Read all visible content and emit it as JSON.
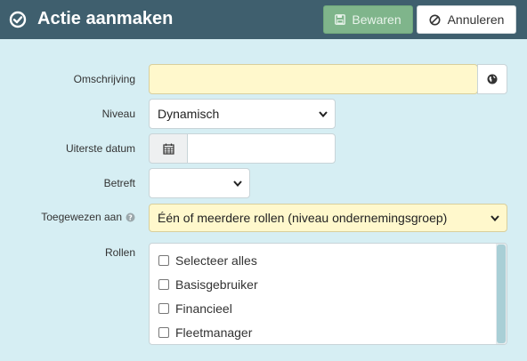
{
  "header": {
    "title": "Actie aanmaken",
    "save_label": "Bewaren",
    "cancel_label": "Annuleren"
  },
  "form": {
    "omschrijving": {
      "label": "Omschrijving",
      "value": ""
    },
    "niveau": {
      "label": "Niveau",
      "value": "Dynamisch"
    },
    "uiterste_datum": {
      "label": "Uiterste datum",
      "value": ""
    },
    "betreft": {
      "label": "Betreft",
      "value": ""
    },
    "toegewezen_aan": {
      "label": "Toegewezen aan",
      "value": "Één of meerdere rollen (niveau ondernemingsgroep)"
    },
    "rollen": {
      "label": "Rollen",
      "items": [
        {
          "label": "Selecteer alles",
          "checked": false
        },
        {
          "label": "Basisgebruiker",
          "checked": false
        },
        {
          "label": "Financieel",
          "checked": false
        },
        {
          "label": "Fleetmanager",
          "checked": false
        }
      ]
    }
  },
  "colors": {
    "header_bg": "#3f5f6e",
    "page_bg": "#d6eef3",
    "save_bg": "#7fb58b",
    "highlight_field": "#fff8cc"
  },
  "icons": [
    "check-circle-icon",
    "floppy-icon",
    "ban-icon",
    "globe-icon",
    "calendar-icon",
    "chevron-down-icon",
    "question-icon"
  ]
}
